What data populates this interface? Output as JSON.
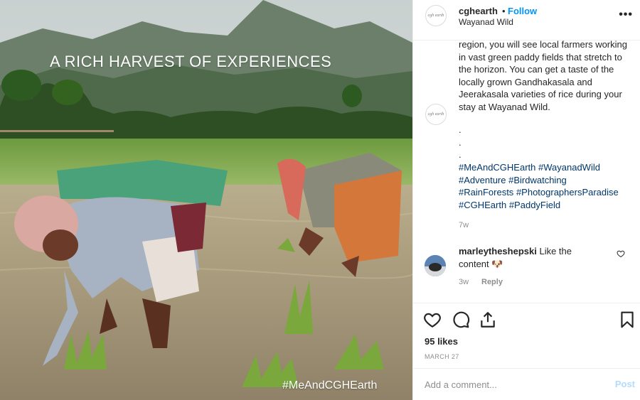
{
  "photo": {
    "headline": "A RICH HARVEST OF EXPERIENCES",
    "tag": "#MeAndCGHEarth"
  },
  "post": {
    "username": "cghearth",
    "separator": "•",
    "follow_label": "Follow",
    "location": "Wayanad Wild",
    "more_icon": "more-icon",
    "avatar_text": "cgh earth"
  },
  "caption": {
    "text": "region, you will see local farmers working in vast green paddy fields that stretch to the horizon. You can get a taste of the locally grown Gandhakasala and Jeerakasala varieties of rice during your stay at Wayanad Wild.",
    "dots": [
      ".",
      ".",
      "."
    ],
    "hashtags": [
      "#MeAndCGHEarth",
      "#WayanadWild",
      "#Adventure",
      "#Birdwatching",
      "#RainForests",
      "#PhotographersParadise",
      "#CGHEarth",
      "#PaddyField"
    ],
    "time": "7w"
  },
  "comment": {
    "username": "marleytheshepski",
    "text": "Like the content",
    "emoji": "🐶",
    "time": "3w",
    "reply_label": "Reply"
  },
  "actions": {
    "likes": "95 likes",
    "date": "MARCH 27"
  },
  "add_comment": {
    "placeholder": "Add a comment...",
    "post_label": "Post"
  },
  "colors": {
    "link": "#0095f6",
    "hashtag": "#00376b",
    "muted": "#8e8e8e"
  }
}
